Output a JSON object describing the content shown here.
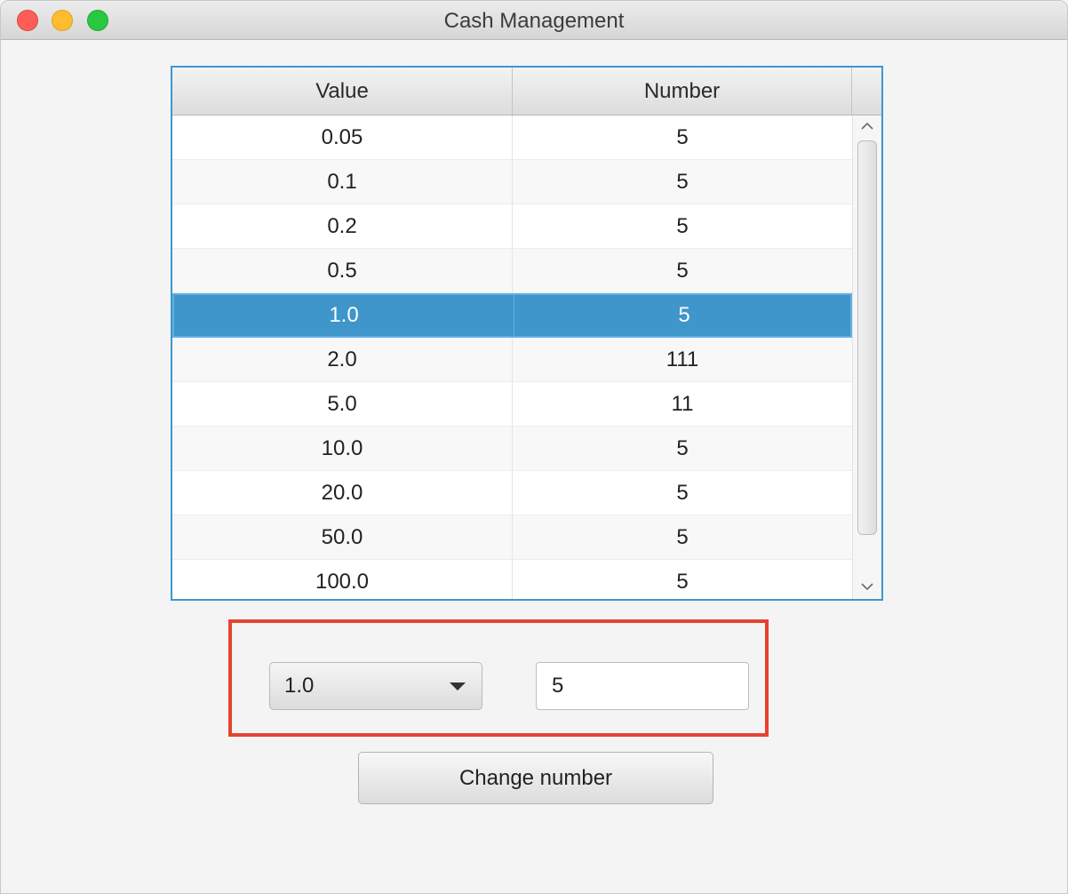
{
  "window": {
    "title": "Cash Management"
  },
  "table": {
    "columns": [
      "Value",
      "Number"
    ],
    "selected_index": 4,
    "rows": [
      {
        "value": "0.05",
        "number": "5"
      },
      {
        "value": "0.1",
        "number": "5"
      },
      {
        "value": "0.2",
        "number": "5"
      },
      {
        "value": "0.5",
        "number": "5"
      },
      {
        "value": "1.0",
        "number": "5"
      },
      {
        "value": "2.0",
        "number": "111"
      },
      {
        "value": "5.0",
        "number": "11"
      },
      {
        "value": "10.0",
        "number": "5"
      },
      {
        "value": "20.0",
        "number": "5"
      },
      {
        "value": "50.0",
        "number": "5"
      },
      {
        "value": "100.0",
        "number": "5"
      }
    ]
  },
  "form": {
    "value_select": "1.0",
    "number_input": "5",
    "change_button_label": "Change number"
  },
  "colors": {
    "selection": "#3e96cb",
    "table_border": "#3e96d0",
    "highlight_box": "#e64331"
  },
  "icons": {
    "scroll_up": "chevron-up-icon",
    "scroll_down": "chevron-down-icon",
    "dropdown": "caret-down-icon"
  }
}
